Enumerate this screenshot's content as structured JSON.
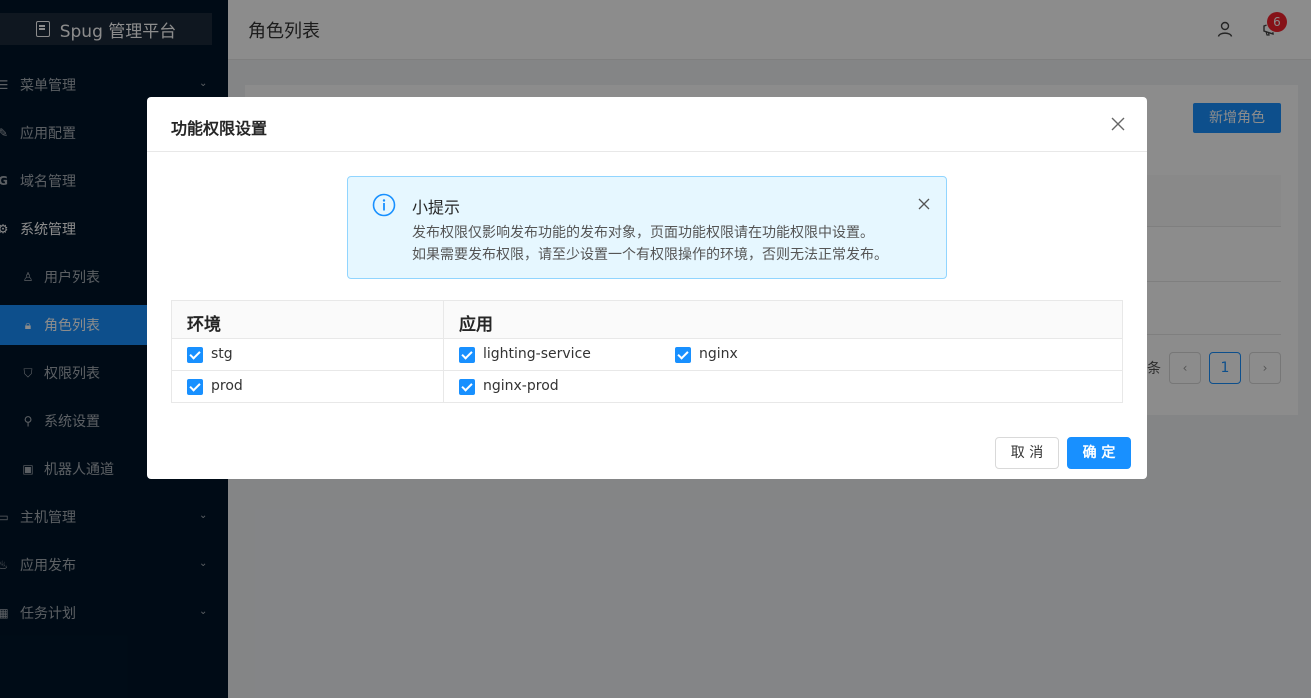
{
  "app": {
    "title": "Spug 管理平台"
  },
  "sidebar": {
    "items": [
      {
        "label": "菜单管理",
        "icon": "menu-icon"
      },
      {
        "label": "应用配置",
        "icon": "tool-icon"
      },
      {
        "label": "域名管理",
        "icon": "google-icon"
      },
      {
        "label": "系统管理",
        "icon": "setting-icon"
      },
      {
        "label": "主机管理",
        "icon": "desktop-icon"
      },
      {
        "label": "应用发布",
        "icon": "deploy-icon"
      },
      {
        "label": "任务计划",
        "icon": "schedule-icon"
      }
    ],
    "sub_items": [
      {
        "label": "用户列表",
        "icon": "user-icon"
      },
      {
        "label": "角色列表",
        "icon": "lock-icon"
      },
      {
        "label": "权限列表",
        "icon": "shield-icon"
      },
      {
        "label": "系统设置",
        "icon": "search-icon"
      },
      {
        "label": "机器人通道",
        "icon": "robot-icon"
      }
    ]
  },
  "header": {
    "title": "角色列表",
    "notification_count": "6"
  },
  "content": {
    "add_role_label": "新增角色",
    "pager_suffix": "条",
    "current_page": "1",
    "prev_icon": "‹",
    "next_icon": "›"
  },
  "modal": {
    "title": "功能权限设置",
    "alert": {
      "title": "小提示",
      "line1": "发布权限仅影响发布功能的发布对象，页面功能权限请在功能权限中设置。",
      "line2": "如果需要发布权限，请至少设置一个有权限操作的环境，否则无法正常发布。"
    },
    "table": {
      "headers": [
        "环境",
        "应用"
      ],
      "rows": [
        {
          "env": "stg",
          "env_checked": true,
          "apps": [
            {
              "name": "lighting-service",
              "checked": true
            },
            {
              "name": "nginx",
              "checked": true
            }
          ]
        },
        {
          "env": "prod",
          "env_checked": true,
          "apps": [
            {
              "name": "nginx-prod",
              "checked": true
            }
          ]
        }
      ]
    },
    "cancel_label": "取 消",
    "ok_label": "确 定"
  },
  "colors": {
    "primary": "#1890ff",
    "sidebar_bg": "#001529",
    "badge": "#f5222d",
    "alert_bg": "#e6f7ff"
  }
}
